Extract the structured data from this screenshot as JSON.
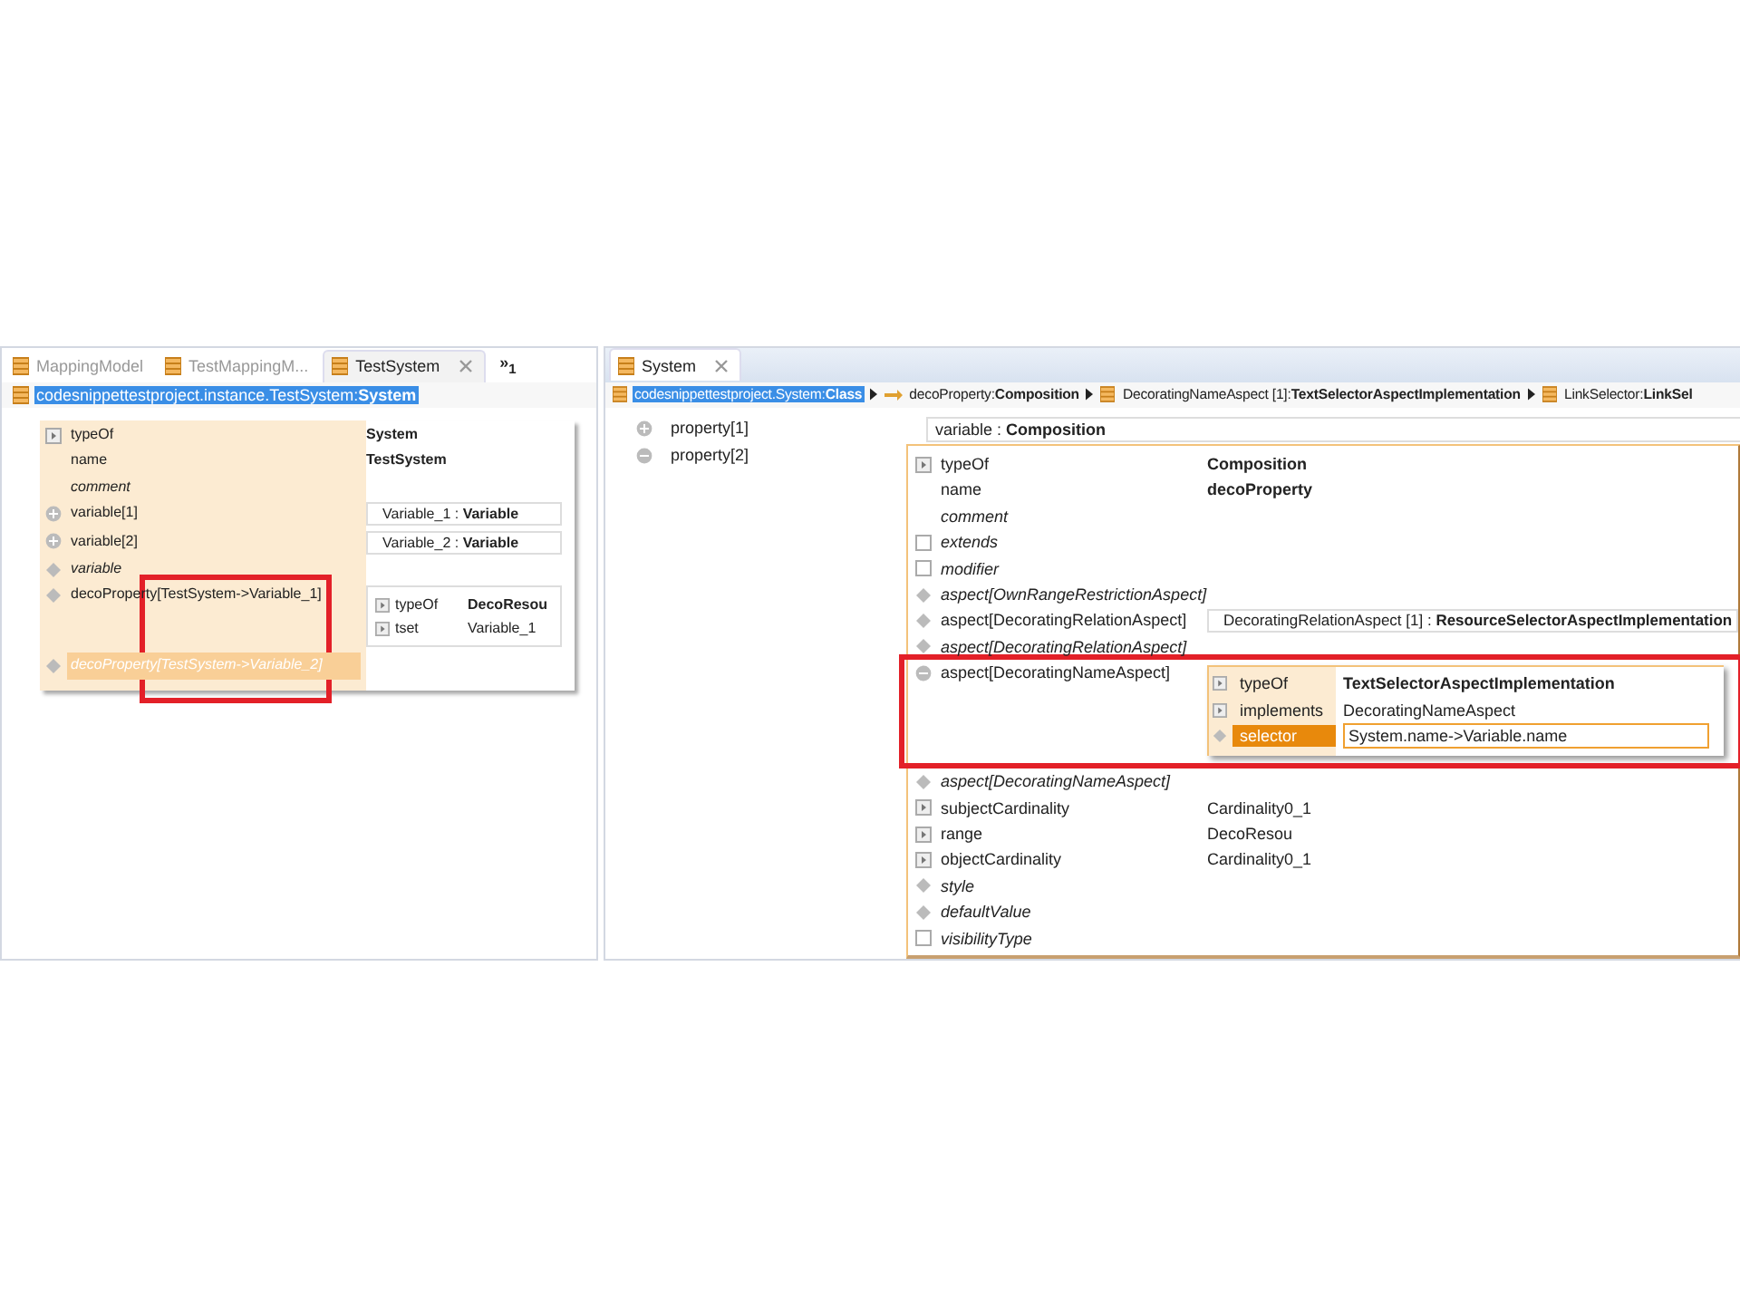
{
  "left_editor": {
    "tabs": [
      {
        "label": "MappingModel",
        "selected": false
      },
      {
        "label": "TestMappingM...",
        "selected": false
      },
      {
        "label": "TestSystem",
        "selected": true
      }
    ],
    "overflow": "»$_{1}$",
    "breadcrumb": [
      {
        "text": "codesnippettestproject.instance.TestSystem:**System**",
        "selected": true
      }
    ],
    "rows": [
      {
        "label": "typeOf",
        "kind": "expand",
        "italic": false,
        "selected": false,
        "value": {
          "kind": "bold",
          "text": "System"
        }
      },
      {
        "label": "name",
        "kind": "none",
        "italic": false,
        "selected": false,
        "value": {
          "kind": "bold",
          "text": "TestSystem"
        }
      },
      {
        "label": "comment",
        "kind": "none",
        "italic": true,
        "selected": false
      },
      {
        "label": "variable[1]",
        "kind": "plus",
        "italic": false,
        "selected": false,
        "value": {
          "kind": "ref",
          "text": "Variable_1 : **Variable**"
        }
      },
      {
        "label": "variable[2]",
        "kind": "plus",
        "italic": false,
        "selected": false,
        "value": {
          "kind": "ref",
          "text": "Variable_2 : **Variable**"
        }
      },
      {
        "label": "variable",
        "kind": "diamond",
        "italic": true,
        "selected": false
      },
      {
        "label": "decoProperty[TestSystem->Variable_1]",
        "kind": "diamond",
        "italic": false,
        "selected": false,
        "value": {
          "kind": "nested",
          "rows": [
            {
              "label": "typeOf",
              "kind": "expand",
              "selected": false,
              "value": {
                "kind": "bold",
                "text": "DecoResou"
              }
            },
            {
              "label": "tset",
              "kind": "expand",
              "selected": false,
              "value": {
                "kind": "text",
                "text": "Variable_1"
              }
            }
          ]
        }
      },
      {
        "label": "decoProperty[TestSystem->Variable_2]",
        "kind": "diamond",
        "italic": true,
        "selected": true
      }
    ]
  },
  "right_editor": {
    "tabs": [
      {
        "label": "System",
        "selected": true
      }
    ],
    "breadcrumb": [
      {
        "text": "codesnippettestproject.System:**Class**",
        "selected": true
      },
      {
        "text": "decoProperty:**Composition**",
        "selected": false
      },
      {
        "text": "DecoratingNameAspect [1]:**TextSelectorAspectImplementation**",
        "selected": false
      },
      {
        "text": "LinkSelector:**LinkSel**",
        "selected": false
      }
    ],
    "outline": [
      {
        "label": "property[1]",
        "kind": "plus",
        "selected": false
      },
      {
        "label": "property[2]",
        "kind": "minus",
        "selected": false
      }
    ],
    "reference": "variable : **Composition**",
    "rows": [
      {
        "label": "typeOf",
        "kind": "expand",
        "italic": false,
        "selected": false,
        "value": {
          "kind": "bold",
          "text": "Composition"
        }
      },
      {
        "label": "name",
        "kind": "none",
        "italic": false,
        "selected": false,
        "value": {
          "kind": "bold",
          "text": "decoProperty"
        }
      },
      {
        "label": "comment",
        "kind": "none",
        "italic": true,
        "selected": false
      },
      {
        "label": "extends",
        "kind": "square",
        "italic": true,
        "selected": false
      },
      {
        "label": "modifier",
        "kind": "square",
        "italic": true,
        "selected": false
      },
      {
        "label": "aspect[OwnRangeRestrictionAspect]",
        "kind": "diamond",
        "italic": true,
        "selected": false
      },
      {
        "label": "aspect[DecoratingRelationAspect]",
        "kind": "diamond",
        "italic": false,
        "selected": false,
        "value": {
          "kind": "ref",
          "text": "DecoratingRelationAspect [1] : **ResourceSelectorAspectImplementation**"
        }
      },
      {
        "label": "aspect[DecoratingRelationAspect]",
        "kind": "diamond",
        "italic": true,
        "selected": false
      },
      {
        "label": "aspect[DecoratingNameAspect]",
        "kind": "minus",
        "italic": false,
        "selected": false,
        "value": {
          "kind": "popup",
          "rows": [
            {
              "label": "typeOf",
              "kind": "expand",
              "selected": false,
              "value": {
                "kind": "bold",
                "text": "TextSelectorAspectImplementation"
              }
            },
            {
              "label": "implements",
              "kind": "expand",
              "selected": false,
              "value": {
                "kind": "text",
                "text": "DecoratingNameAspect"
              }
            },
            {
              "label": "selector",
              "kind": "diamond",
              "selected": true,
              "value": {
                "kind": "field",
                "text": "System.name->Variable.name"
              }
            }
          ]
        }
      },
      {
        "label": "aspect[DecoratingNameAspect]",
        "kind": "diamond",
        "italic": true,
        "selected": false
      },
      {
        "label": "subjectCardinality",
        "kind": "expand",
        "italic": false,
        "selected": false,
        "value": {
          "kind": "text",
          "text": "Cardinality0_1"
        }
      },
      {
        "label": "range",
        "kind": "expand",
        "italic": false,
        "selected": false,
        "value": {
          "kind": "text",
          "text": "DecoResou"
        }
      },
      {
        "label": "objectCardinality",
        "kind": "expand",
        "italic": false,
        "selected": false,
        "value": {
          "kind": "text",
          "text": "Cardinality0_1"
        }
      },
      {
        "label": "style",
        "kind": "diamond",
        "italic": true,
        "selected": false
      },
      {
        "label": "defaultValue",
        "kind": "diamond",
        "italic": true,
        "selected": false
      },
      {
        "label": "visibilityType",
        "kind": "square",
        "italic": true,
        "selected": false
      }
    ]
  }
}
